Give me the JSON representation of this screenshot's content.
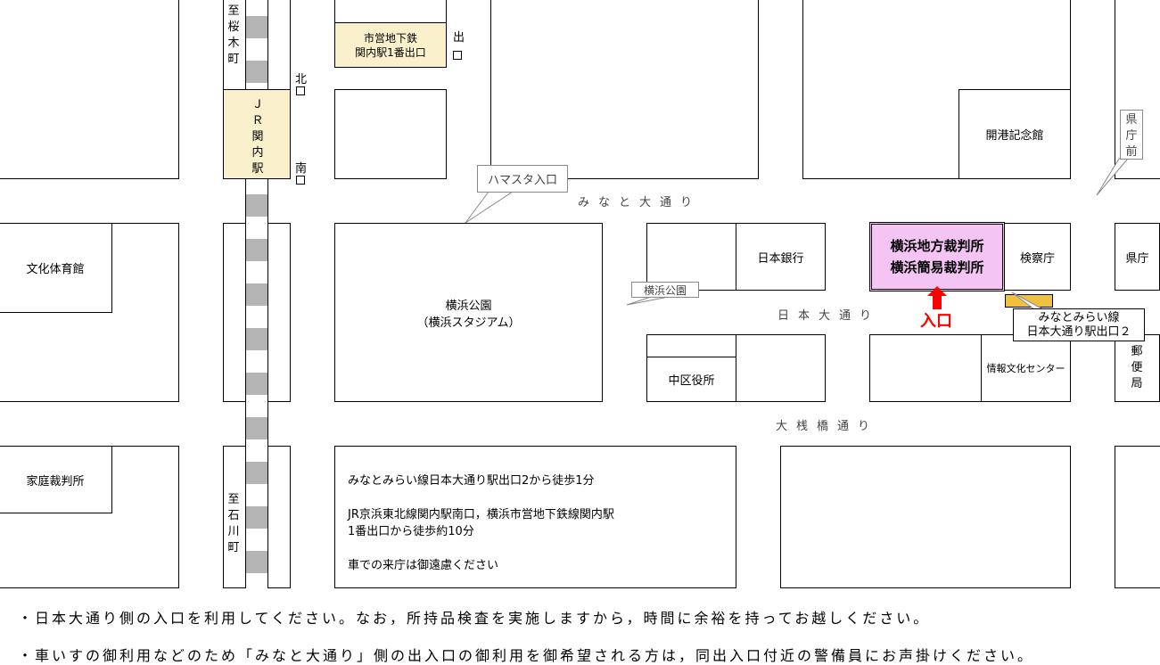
{
  "stations": {
    "jr_kannai": "ＪＲ関内駅",
    "subway_exit": "市営地下鉄\n関内駅1番出口",
    "exit_label": "出\n口",
    "north_exit": "北\n口",
    "south_exit": "南\n口",
    "to_sakuragicho": "至桜木町",
    "to_ishikawacho": "至石川町"
  },
  "roads": {
    "minato_odori": "みなと大通り",
    "nihon_odori": "日本大通り",
    "osanbashi_dori": "大桟橋通り"
  },
  "buildings": {
    "kaiko_kinenkan": "開港記念館",
    "bunka_taiikukan": "文化体育館",
    "yokohama_park": "横浜公園",
    "yokohama_stadium": "（横浜スタジアム）",
    "bank_of_japan": "日本銀行",
    "court_line1": "横浜地方裁判所",
    "court_line2": "横浜簡易裁判所",
    "prosecutors": "検察庁",
    "prefecture": "県庁",
    "naka_ward": "中区役所",
    "info_culture": "情報文化センター",
    "post_office": "郵便局",
    "family_court": "家庭裁判所"
  },
  "callouts": {
    "hamasuta": "ハマスタ入口",
    "yokohama_park": "横浜公園",
    "kenchomae": "県庁前",
    "minatomirai_exit": "みなとみらい線\n日本大通り駅出口２"
  },
  "entrance_label": "入口",
  "access_info": [
    "みなとみらい線日本大通り駅出口2から徒歩1分",
    "JR京浜東北線関内駅南口，横浜市営地下鉄線関内駅",
    "1番出口から徒歩約10分",
    "車での来庁は御遠慮ください"
  ],
  "notes": [
    "・日本大通り側の入口を利用してください。なお，所持品検査を実施しますから，時間に余裕を持ってお越しください。",
    "・車いすの御利用などのため「みなと大通り」側の出入口の御利用を御希望される方は，同出入口付近の警備員にお声掛けください。"
  ],
  "colors": {
    "court_fill": "#f4c4f4",
    "station_fill": "#fbf0cc",
    "exit_fill": "#f0c040",
    "entrance": "#ff0000",
    "rail_dark": "#b4b4b4"
  }
}
